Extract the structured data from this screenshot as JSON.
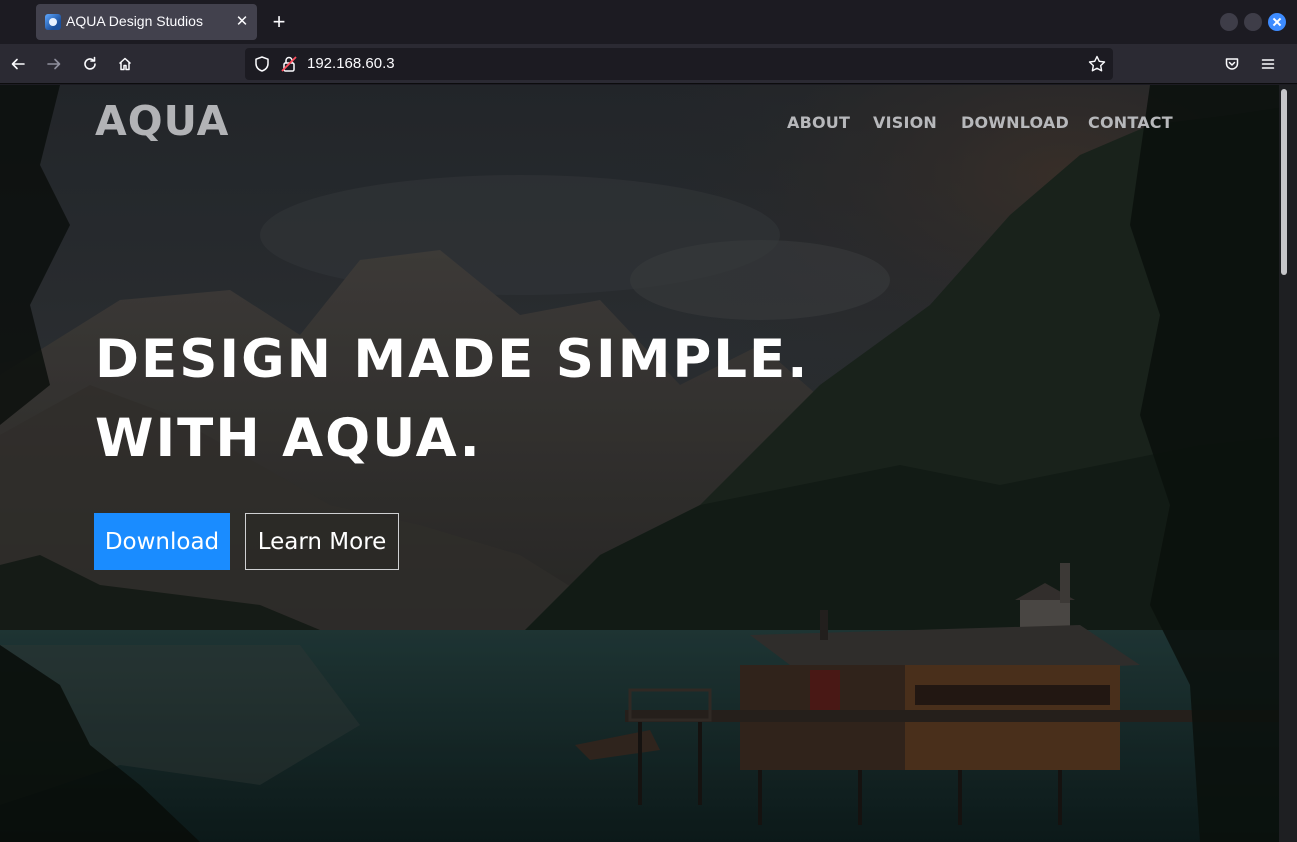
{
  "browser": {
    "tab": {
      "title": "AQUA Design Studios",
      "favicon": "aqua-logo-icon",
      "close_glyph": "✕"
    },
    "new_tab_glyph": "+",
    "url": "192.168.60.3",
    "icons": {
      "back": "back-arrow-icon",
      "forward": "forward-arrow-icon",
      "reload": "reload-icon",
      "home": "home-icon",
      "shield": "shield-icon",
      "lock": "insecure-lock-icon",
      "bookmark": "star-icon",
      "pocket": "pocket-icon",
      "menu": "hamburger-menu-icon"
    },
    "colors": {
      "chrome_dark": "#1c1b22",
      "toolbar": "#2b2a33",
      "tab_active": "#42414d",
      "close_button": "#3d8bff"
    }
  },
  "site": {
    "brand": "AQUA",
    "nav": {
      "about": "ABOUT",
      "vision": "VISION",
      "download": "DOWNLOAD",
      "contact": "CONTACT"
    },
    "hero": {
      "line1": "DESIGN MADE SIMPLE.",
      "line2": "WITH AQUA.",
      "primary_button": "Download",
      "secondary_button": "Learn More"
    },
    "colors": {
      "accent": "#1a8cff",
      "nav_text": "#b7b8bb",
      "headline": "#ffffff"
    }
  }
}
